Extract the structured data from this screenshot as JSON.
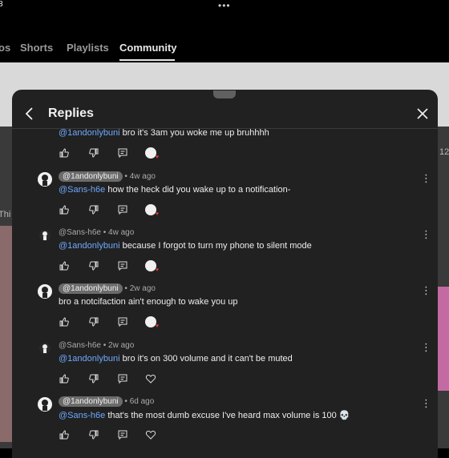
{
  "status": {
    "time_fragment": "8",
    "dots": "•••"
  },
  "tabs": [
    {
      "label": "os"
    },
    {
      "label": "Shorts"
    },
    {
      "label": "Playlists"
    },
    {
      "label": "Community"
    }
  ],
  "background_edge": {
    "left_text": "Thi",
    "right_num": "12"
  },
  "sheet": {
    "title": "Replies"
  },
  "comments": [
    {
      "author": "",
      "time": "",
      "mention": "@1andonlybuni",
      "text": " bro it's 3am you woke me up bruhhhh",
      "pill": false
    },
    {
      "author": "@1andonlybuni",
      "time": "4w ago",
      "mention": "@Sans-h6e",
      "text": " how the heck did you wake up to a notification-",
      "pill": true
    },
    {
      "author": "@Sans-h6e",
      "time": "4w ago",
      "mention": "@1andonlybuni",
      "text": " because I forgot to turn my phone to silent mode",
      "pill": false
    },
    {
      "author": "@1andonlybuni",
      "time": "2w ago",
      "mention": "",
      "text": "bro a notcifaction ain't enough to wake you up",
      "pill": true
    },
    {
      "author": "@Sans-h6e",
      "time": "2w ago",
      "mention": "@1andonlybuni",
      "text": " bro it's on 300 volume and it can't be muted",
      "pill": false
    },
    {
      "author": "@1andonlybuni",
      "time": "6d ago",
      "mention": "@Sans-h6e",
      "text": " that's the most dumb excuse I've heard max volume is 100 ",
      "emoji": "💀",
      "pill": true
    }
  ],
  "colors": {
    "sheet_bg": "#212121",
    "mention": "#6ea8fe",
    "pill_bg": "#6b6b6b",
    "creator_heart": "#e53935"
  },
  "icons": [
    "back-arrow-icon",
    "close-icon",
    "thumbs-up-icon",
    "thumbs-down-icon",
    "reply-icon",
    "creator-heart-icon",
    "heart-icon",
    "more-vert-icon"
  ]
}
